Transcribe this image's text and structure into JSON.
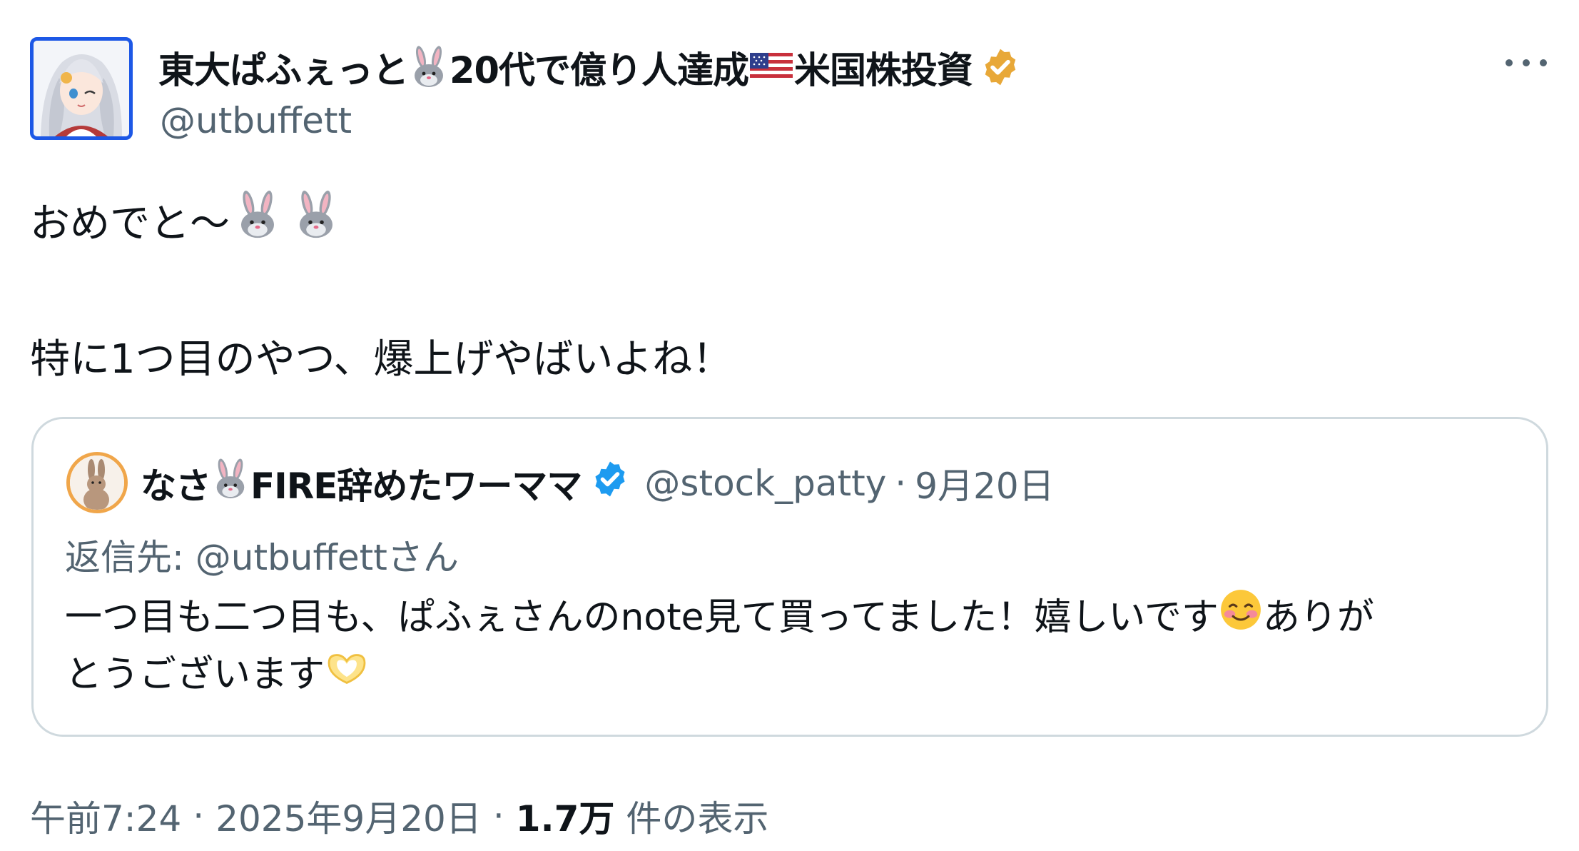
{
  "author": {
    "name_part1": "東大ぱふぇっと",
    "name_part2": "20代で億り人達成",
    "name_part3": "米国株投資",
    "handle": "@utbuffett",
    "avatar_icon": "anime-girl-avatar",
    "verified_badge": "gold-verified-badge-icon",
    "emoji": [
      "rabbit-emoji",
      "us-flag-emoji"
    ]
  },
  "tweet": {
    "line1": "おめでと〜",
    "line2": "特に1つ目のやつ、爆上げやばいよね！",
    "line1_emoji": [
      "rabbit-emoji",
      "rabbit-emoji"
    ]
  },
  "quote": {
    "name_part1": "なさ",
    "name_part2": "FIRE辞めたワーママ",
    "handle": "@stock_patty",
    "separator": "·",
    "date": "9月20日",
    "reply_prefix": "返信先: ",
    "reply_mention": "@utbuffett",
    "reply_suffix": "さん",
    "text_line1_a": "一つ目も二つ目も、ぱふぇさんのnote見て買ってました！嬉しいです",
    "text_line1_b": "ありが",
    "text_line2": "とうございます",
    "avatar_icon": "rabbit-avatar",
    "verified_badge": "blue-verified-badge-icon",
    "emoji": [
      "rabbit-emoji",
      "smiling-face-emoji",
      "heart-hands-emoji"
    ]
  },
  "footer": {
    "time": "午前7:24",
    "separator": "·",
    "date": "2025年9月20日",
    "views_count": "1.7万",
    "views_label": "件の表示"
  },
  "colors": {
    "text_primary": "#0f1419",
    "text_secondary": "#536471",
    "border": "#cfd9de",
    "blue_verified": "#1d9bf0",
    "gold_verified": "#e8a838",
    "avatar_border": "#1d58e6"
  }
}
